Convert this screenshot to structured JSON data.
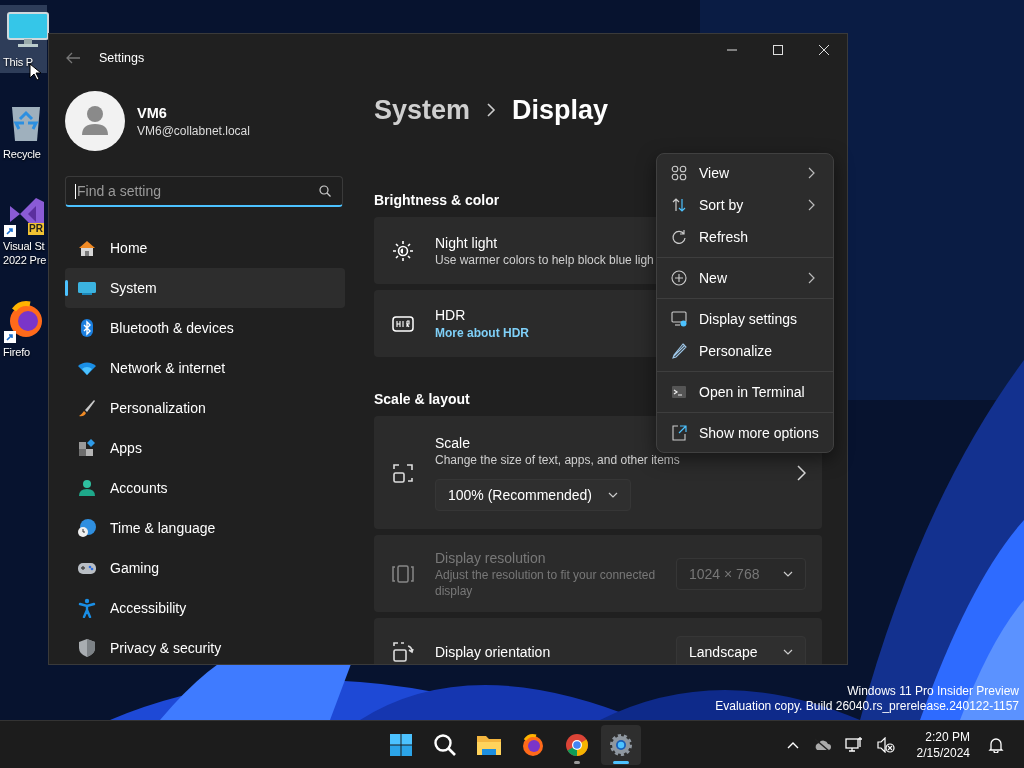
{
  "wallpaper": {
    "kind": "picture"
  },
  "desktop_icons": [
    {
      "lines": [
        "This P"
      ],
      "selected": true,
      "shortcut": false
    },
    {
      "lines": [
        "Recycle"
      ],
      "selected": false,
      "shortcut": false
    },
    {
      "lines": [
        "Visual St",
        "2022 Pre"
      ],
      "selected": false,
      "shortcut": true,
      "badge": "PR"
    },
    {
      "lines": [
        "Firefo"
      ],
      "selected": false,
      "shortcut": true
    }
  ],
  "build_info": [
    "Windows 11 Pro Insider Preview",
    "Evaluation copy. Build 26040.rs_prerelease.240122-1157"
  ],
  "window": {
    "title": "Settings"
  },
  "profile": {
    "name": "VM6",
    "email": "VM6@collabnet.local"
  },
  "search": {
    "placeholder": "Find a setting",
    "focused": true
  },
  "nav": [
    {
      "label": "Home",
      "selected": false
    },
    {
      "label": "System",
      "selected": true
    },
    {
      "label": "Bluetooth & devices",
      "selected": false
    },
    {
      "label": "Network & internet",
      "selected": false
    },
    {
      "label": "Personalization",
      "selected": false
    },
    {
      "label": "Apps",
      "selected": false
    },
    {
      "label": "Accounts",
      "selected": false
    },
    {
      "label": "Time & language",
      "selected": false
    },
    {
      "label": "Gaming",
      "selected": false
    },
    {
      "label": "Accessibility",
      "selected": false
    },
    {
      "label": "Privacy & security",
      "selected": false
    }
  ],
  "breadcrumb": [
    "System",
    "Display"
  ],
  "sections": [
    {
      "title": "Brightness & color",
      "cards": [
        {
          "kind": "row",
          "title": "Night light",
          "description": "Use warmer colors to help block blue ligh",
          "disabled": false
        },
        {
          "kind": "row",
          "title": "HDR",
          "link": "More about HDR",
          "disabled": false
        }
      ]
    },
    {
      "title": "Scale & layout",
      "cards": [
        {
          "kind": "stacked",
          "title": "Scale",
          "description": "Change the size of text, apps, and other items",
          "dropdown": "100% (Recommended)",
          "disabled": false
        },
        {
          "kind": "row",
          "title": "Display resolution",
          "description": "Adjust the resolution to fit your connected display",
          "dropdown": "1024 × 768",
          "disabled": true
        },
        {
          "kind": "row",
          "title": "Display orientation",
          "dropdown": "Landscape",
          "disabled": false
        }
      ]
    }
  ],
  "context_menu": {
    "groups": [
      [
        {
          "label": "View",
          "submenu": true
        },
        {
          "label": "Sort by",
          "submenu": true
        },
        {
          "label": "Refresh",
          "submenu": false
        }
      ],
      [
        {
          "label": "New",
          "submenu": true
        }
      ],
      [
        {
          "label": "Display settings",
          "submenu": false
        },
        {
          "label": "Personalize",
          "submenu": false
        }
      ],
      [
        {
          "label": "Open in Terminal",
          "submenu": false
        }
      ],
      [
        {
          "label": "Show more options",
          "submenu": false
        }
      ]
    ]
  },
  "taskbar": {
    "apps": [
      {
        "running": false,
        "selected": false
      },
      {
        "running": false,
        "selected": false
      },
      {
        "running": false,
        "selected": false
      },
      {
        "running": false,
        "selected": false
      },
      {
        "running": true,
        "selected": false
      },
      {
        "running": true,
        "selected": true
      }
    ],
    "time": "2:20 PM",
    "date": "2/15/2024"
  }
}
